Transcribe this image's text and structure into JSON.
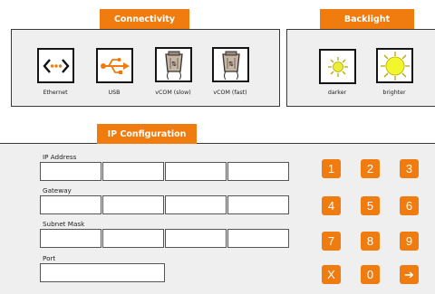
{
  "connectivity": {
    "title": "Connectivity",
    "items": [
      {
        "label": "Ethernet",
        "icon": "ethernet-icon"
      },
      {
        "label": "USB",
        "icon": "usb-icon"
      },
      {
        "label": "vCOM (slow)",
        "icon": "vcom-slow-icon"
      },
      {
        "label": "vCOM (fast)",
        "icon": "vcom-fast-icon"
      }
    ]
  },
  "backlight": {
    "title": "Backlight",
    "items": [
      {
        "label": "darker",
        "icon": "sun-small-icon"
      },
      {
        "label": "brighter",
        "icon": "sun-large-icon"
      }
    ]
  },
  "ip_config": {
    "title": "IP Configuration",
    "ip_label": "IP Address",
    "gateway_label": "Gateway",
    "subnet_label": "Subnet Mask",
    "port_label": "Port"
  },
  "keypad": {
    "keys": [
      "1",
      "2",
      "3",
      "4",
      "5",
      "6",
      "7",
      "8",
      "9",
      "X",
      "0",
      "➔"
    ]
  },
  "colors": {
    "accent": "#f07c0f",
    "panel_bg": "#efefef",
    "border": "#3a3a3a"
  }
}
